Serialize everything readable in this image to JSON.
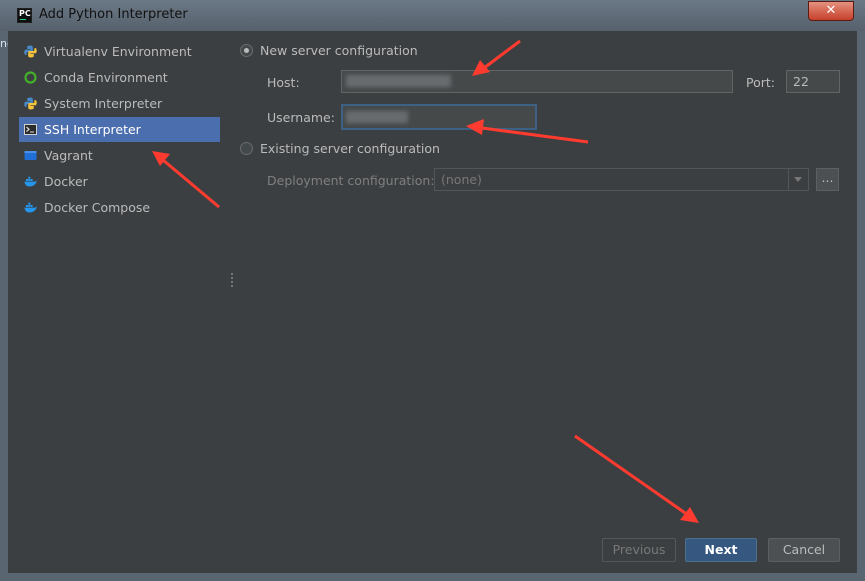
{
  "window": {
    "title": "Add Python Interpreter",
    "app_icon_text": "PC",
    "close_label": "✕",
    "edge_text": "ne"
  },
  "sidebar": {
    "items": [
      {
        "label": "Virtualenv Environment",
        "icon": "python-icon",
        "active": false
      },
      {
        "label": "Conda Environment",
        "icon": "conda-ring-icon",
        "active": false
      },
      {
        "label": "System Interpreter",
        "icon": "python-icon",
        "active": false
      },
      {
        "label": "SSH Interpreter",
        "icon": "terminal-icon",
        "active": true
      },
      {
        "label": "Vagrant",
        "icon": "vagrant-icon",
        "active": false
      },
      {
        "label": "Docker",
        "icon": "docker-icon",
        "active": false
      },
      {
        "label": "Docker Compose",
        "icon": "docker-icon",
        "active": false
      }
    ]
  },
  "main": {
    "new_server": {
      "label": "New server configuration",
      "checked": true
    },
    "host": {
      "label": "Host:",
      "value": ""
    },
    "port": {
      "label": "Port:",
      "value": "22"
    },
    "username": {
      "label": "Username:",
      "value": ""
    },
    "existing_server": {
      "label": "Existing server configuration",
      "checked": false
    },
    "deployment": {
      "label": "Deployment configuration:",
      "value": "(none)",
      "browse_label": "..."
    }
  },
  "buttons": {
    "previous": "Previous",
    "next": "Next",
    "cancel": "Cancel"
  },
  "colors": {
    "accent": "#4b6eaf",
    "annotation_arrow": "#ff3b30",
    "primary_button": "#365880"
  }
}
